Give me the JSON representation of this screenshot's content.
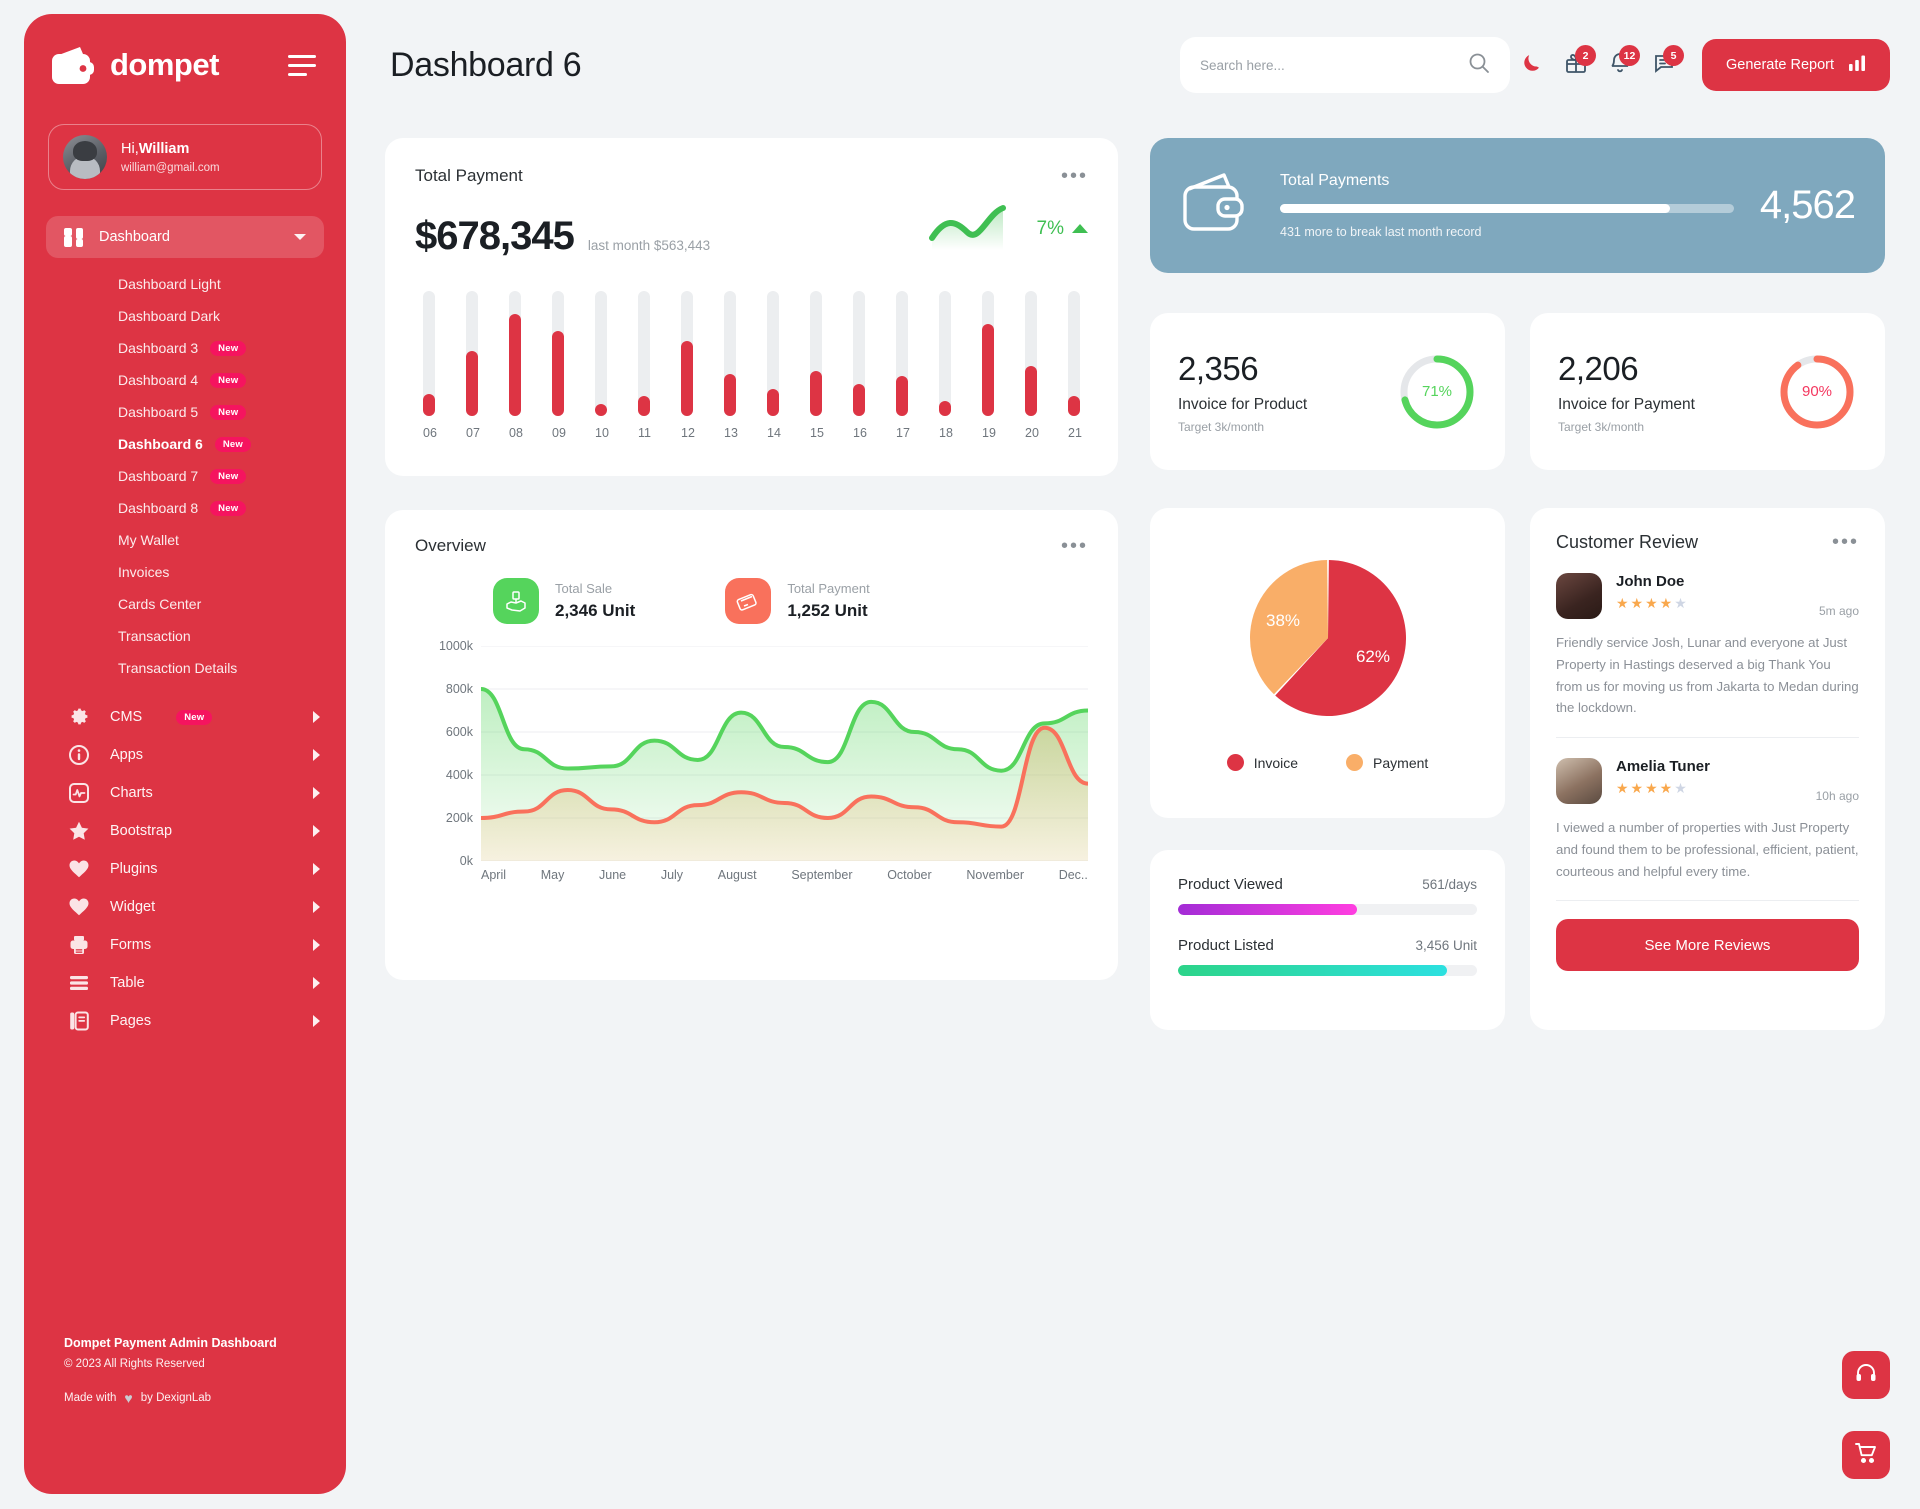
{
  "brand": {
    "name": "dompet",
    "logo_icon": "wallet-icon",
    "menu_icon": "hamburger-icon"
  },
  "profile": {
    "greeting_prefix": "Hi,",
    "name": "William",
    "email": "william@gmail.com"
  },
  "sidebar": {
    "main_item": {
      "label": "Dashboard",
      "icon": "grid-icon",
      "caret": "chevron-down-icon"
    },
    "sub_items": [
      {
        "label": "Dashboard Light",
        "badge": "",
        "active": false
      },
      {
        "label": "Dashboard Dark",
        "badge": "",
        "active": false
      },
      {
        "label": "Dashboard 3",
        "badge": "New",
        "active": false
      },
      {
        "label": "Dashboard 4",
        "badge": "New",
        "active": false
      },
      {
        "label": "Dashboard 5",
        "badge": "New",
        "active": false
      },
      {
        "label": "Dashboard 6",
        "badge": "New",
        "active": true
      },
      {
        "label": "Dashboard 7",
        "badge": "New",
        "active": false
      },
      {
        "label": "Dashboard 8",
        "badge": "New",
        "active": false
      },
      {
        "label": "My Wallet",
        "badge": "",
        "active": false
      },
      {
        "label": "Invoices",
        "badge": "",
        "active": false
      },
      {
        "label": "Cards Center",
        "badge": "",
        "active": false
      },
      {
        "label": "Transaction",
        "badge": "",
        "active": false
      },
      {
        "label": "Transaction Details",
        "badge": "",
        "active": false
      }
    ],
    "groups": [
      {
        "label": "CMS",
        "icon": "gear-icon",
        "badge": "New"
      },
      {
        "label": "Apps",
        "icon": "info-icon",
        "badge": ""
      },
      {
        "label": "Charts",
        "icon": "chart-pulse-icon",
        "badge": ""
      },
      {
        "label": "Bootstrap",
        "icon": "star-icon",
        "badge": ""
      },
      {
        "label": "Plugins",
        "icon": "heart-icon",
        "badge": ""
      },
      {
        "label": "Widget",
        "icon": "heart-icon",
        "badge": ""
      },
      {
        "label": "Forms",
        "icon": "printer-icon",
        "badge": ""
      },
      {
        "label": "Table",
        "icon": "table-icon",
        "badge": ""
      },
      {
        "label": "Pages",
        "icon": "pages-icon",
        "badge": ""
      }
    ],
    "footer": {
      "title": "Dompet Payment Admin Dashboard",
      "copyright": "© 2023 All Rights Reserved",
      "made_prefix": "Made with",
      "made_suffix": "by DexignLab",
      "heart": "♥"
    }
  },
  "header": {
    "title": "Dashboard 6",
    "search_placeholder": "Search here...",
    "search_value": "",
    "search_icon": "search-icon",
    "dark_mode_icon": "moon-icon",
    "icons": [
      {
        "name": "gift-icon",
        "badge": "2"
      },
      {
        "name": "bell-icon",
        "badge": "12"
      },
      {
        "name": "message-icon",
        "badge": "5"
      }
    ],
    "report_button": {
      "label": "Generate Report",
      "icon": "bar-chart-icon"
    }
  },
  "total_payment": {
    "title": "Total Payment",
    "amount": "$678,345",
    "last_month": "last month $563,443",
    "trend_pct": "7%",
    "trend_direction": "up",
    "menu_icon": "more-icon"
  },
  "total_payments_blue": {
    "title": "Total Payments",
    "value": "4,562",
    "note": "431 more to break last month record",
    "progress_pct": 86,
    "icon": "wallet-outline-icon",
    "bg_color": "#7fa8be"
  },
  "invoice_cards": [
    {
      "number": "2,356",
      "name": "Invoice for Product",
      "target": "Target 3k/month",
      "pct": "71%",
      "pct_value": 71,
      "color": "#55d45c"
    },
    {
      "number": "2,206",
      "name": "Invoice for Payment",
      "target": "Target 3k/month",
      "pct": "90%",
      "pct_value": 90,
      "color": "#f9715c"
    }
  ],
  "overview": {
    "title": "Overview",
    "menu_icon": "more-icon",
    "stats": [
      {
        "label": "Total Sale",
        "value": "2,346 Unit",
        "icon": "hand-money-icon",
        "color": "#55d45c"
      },
      {
        "label": "Total Payment",
        "value": "1,252 Unit",
        "icon": "card-swipe-icon",
        "color": "#f9715c"
      }
    ]
  },
  "pie": {
    "menu_icon": ""
  },
  "progress_card": {
    "rows": [
      {
        "name": "Product Viewed",
        "value": "561/days",
        "pct": 60,
        "from": "#a32cd6",
        "to": "#ff3ee0"
      },
      {
        "name": "Product Listed",
        "value": "3,456 Unit",
        "pct": 90,
        "from": "#2cd489",
        "to": "#2ce0e0"
      }
    ]
  },
  "review": {
    "title": "Customer Review",
    "menu_icon": "more-icon",
    "items": [
      {
        "name": "John Doe",
        "stars": 4,
        "max_stars": 5,
        "time": "5m ago",
        "text": "Friendly service Josh, Lunar and everyone at Just Property in Hastings deserved a big Thank You from us for moving us from Jakarta to Medan during the lockdown."
      },
      {
        "name": "Amelia Tuner",
        "stars": 4,
        "max_stars": 5,
        "time": "10h ago",
        "text": "I viewed a number of properties with Just Property and found them to be professional, efficient, patient, courteous and helpful every time."
      }
    ],
    "see_more_label": "See More Reviews"
  },
  "fab": [
    {
      "name": "support-icon",
      "glyph": "🎧"
    },
    {
      "name": "cart-icon",
      "glyph": "🛒"
    }
  ],
  "colors": {
    "brand_red": "#dd3444",
    "green": "#3fbf52",
    "orange": "#f9a84d",
    "blue_card": "#7fa8be"
  },
  "chart_data": [
    {
      "type": "bar",
      "title": "Total Payment",
      "categories": [
        "06",
        "07",
        "08",
        "09",
        "10",
        "11",
        "12",
        "13",
        "14",
        "15",
        "16",
        "17",
        "18",
        "19",
        "20",
        "21"
      ],
      "values": [
        18,
        52,
        82,
        68,
        10,
        16,
        60,
        34,
        22,
        36,
        26,
        32,
        12,
        74,
        40,
        16
      ],
      "ylim": [
        0,
        100
      ],
      "xlabel": "",
      "ylabel": "",
      "grid": false,
      "series_color": "#dd3444",
      "track_color": "#eceef0"
    },
    {
      "type": "line",
      "title": "Total Payment trend sparkline",
      "x": [
        0,
        1,
        2,
        3,
        4,
        5
      ],
      "values": [
        40,
        58,
        48,
        42,
        70,
        82
      ],
      "series_color": "#3fbf52",
      "annotation": "7%"
    },
    {
      "type": "area",
      "title": "Overview",
      "categories": [
        "April",
        "May",
        "June",
        "July",
        "August",
        "September",
        "October",
        "November",
        "Dec.."
      ],
      "ylim": [
        0,
        1000
      ],
      "ytick_labels": [
        "0k",
        "200k",
        "400k",
        "600k",
        "800k",
        "1000k"
      ],
      "ytick_values": [
        0,
        200,
        400,
        600,
        800,
        1000
      ],
      "grid": true,
      "legend": "none",
      "series": [
        {
          "name": "Total Sale",
          "color": "#55d45c",
          "values": [
            800,
            520,
            430,
            440,
            560,
            470,
            690,
            530,
            460,
            740,
            600,
            520,
            420,
            640,
            700
          ]
        },
        {
          "name": "Total Payment",
          "color": "#f9715c",
          "values": [
            200,
            230,
            330,
            240,
            180,
            260,
            320,
            270,
            200,
            300,
            250,
            180,
            160,
            620,
            360
          ]
        }
      ]
    },
    {
      "type": "pie",
      "title": "",
      "labels": [
        "Invoice",
        "Payment"
      ],
      "values": [
        62,
        38
      ],
      "value_labels": [
        "62%",
        "38%"
      ],
      "colors": [
        "#dd3444",
        "#f9ae68"
      ],
      "legend": "bottom"
    }
  ]
}
